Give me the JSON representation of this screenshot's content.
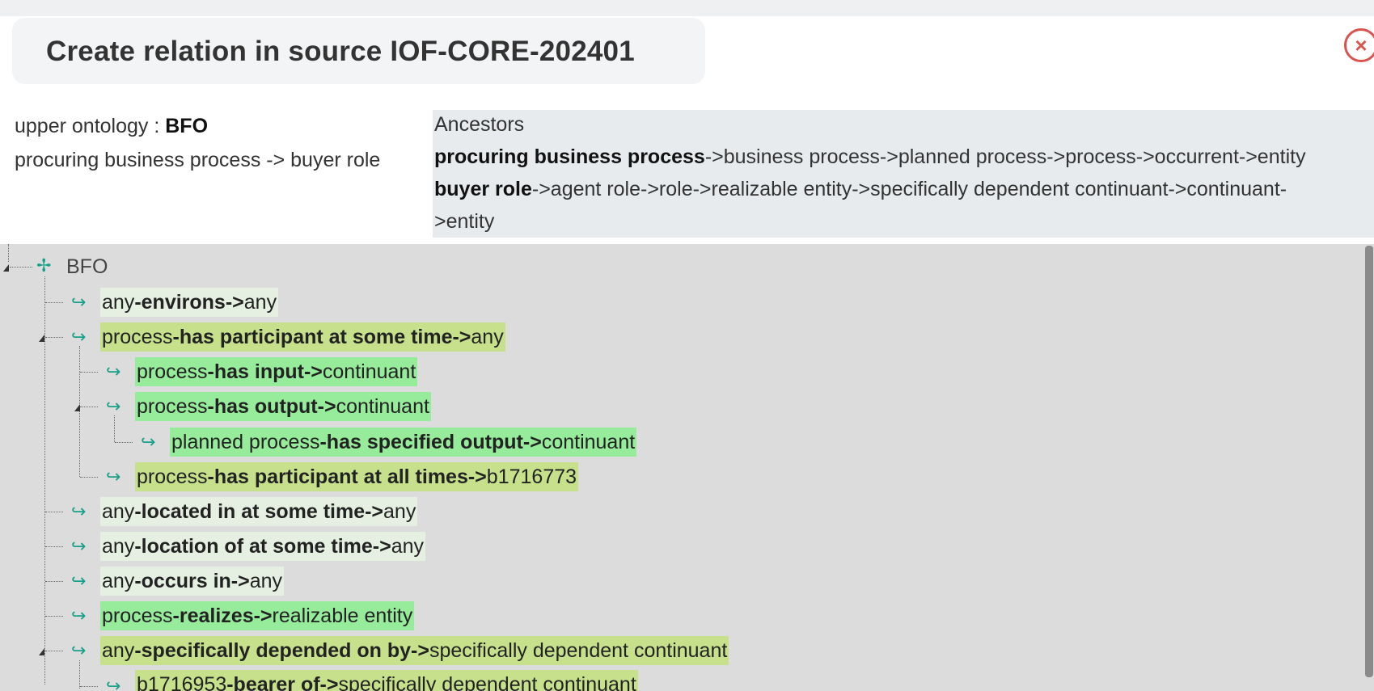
{
  "dialog": {
    "title": "Create relation in source IOF-CORE-202401",
    "close_icon": "close-icon"
  },
  "info": {
    "upper_ontology_label": "upper ontology : ",
    "upper_ontology_value": "BFO",
    "relation_path": "procuring business process -> buyer role"
  },
  "ancestors": {
    "heading": "Ancestors",
    "line1_bold": "procuring business process",
    "line1_rest": "->business process->planned process->process->occurrent->entity",
    "line2_bold": "buyer role",
    "line2_rest": "->agent role->role->realizable entity->specifically dependent continuant->continuant-",
    "line3": ">entity"
  },
  "tree": {
    "root": "BFO",
    "nodes": [
      {
        "domain": "any",
        "rel": "-environs->",
        "range": "any",
        "highlight": "light"
      },
      {
        "domain": "process",
        "rel": "-has participant at some time->",
        "range": "any",
        "highlight": "yellow"
      },
      {
        "domain": "process",
        "rel": "-has input->",
        "range": "continuant",
        "highlight": "green"
      },
      {
        "domain": "process",
        "rel": "-has output->",
        "range": "continuant",
        "highlight": "green"
      },
      {
        "domain": "planned process",
        "rel": "-has specified output->",
        "range": "continuant",
        "highlight": "green"
      },
      {
        "domain": "process",
        "rel": "-has participant at all times->",
        "range": "b1716773",
        "highlight": "yellow"
      },
      {
        "domain": "any",
        "rel": "-located in at some time->",
        "range": "any",
        "highlight": "light"
      },
      {
        "domain": "any",
        "rel": "-location of at some time->",
        "range": "any",
        "highlight": "light"
      },
      {
        "domain": "any",
        "rel": "-occurs in->",
        "range": "any",
        "highlight": "light"
      },
      {
        "domain": "process",
        "rel": "-realizes->",
        "range": "realizable entity",
        "highlight": "green"
      },
      {
        "domain": "any",
        "rel": "-specifically depended on by->",
        "range": "specifically dependent continuant",
        "highlight": "yellow"
      },
      {
        "domain": "b1716953",
        "rel": "-bearer of->",
        "range": "specifically dependent continuant",
        "highlight": "yellow"
      }
    ]
  },
  "colors": {
    "highlight_yellow": "#c6e08c",
    "highlight_green": "#96ec9a",
    "highlight_light": "#e6f0e2",
    "icon_teal": "#1aa08a",
    "close_red": "#d9534f"
  }
}
